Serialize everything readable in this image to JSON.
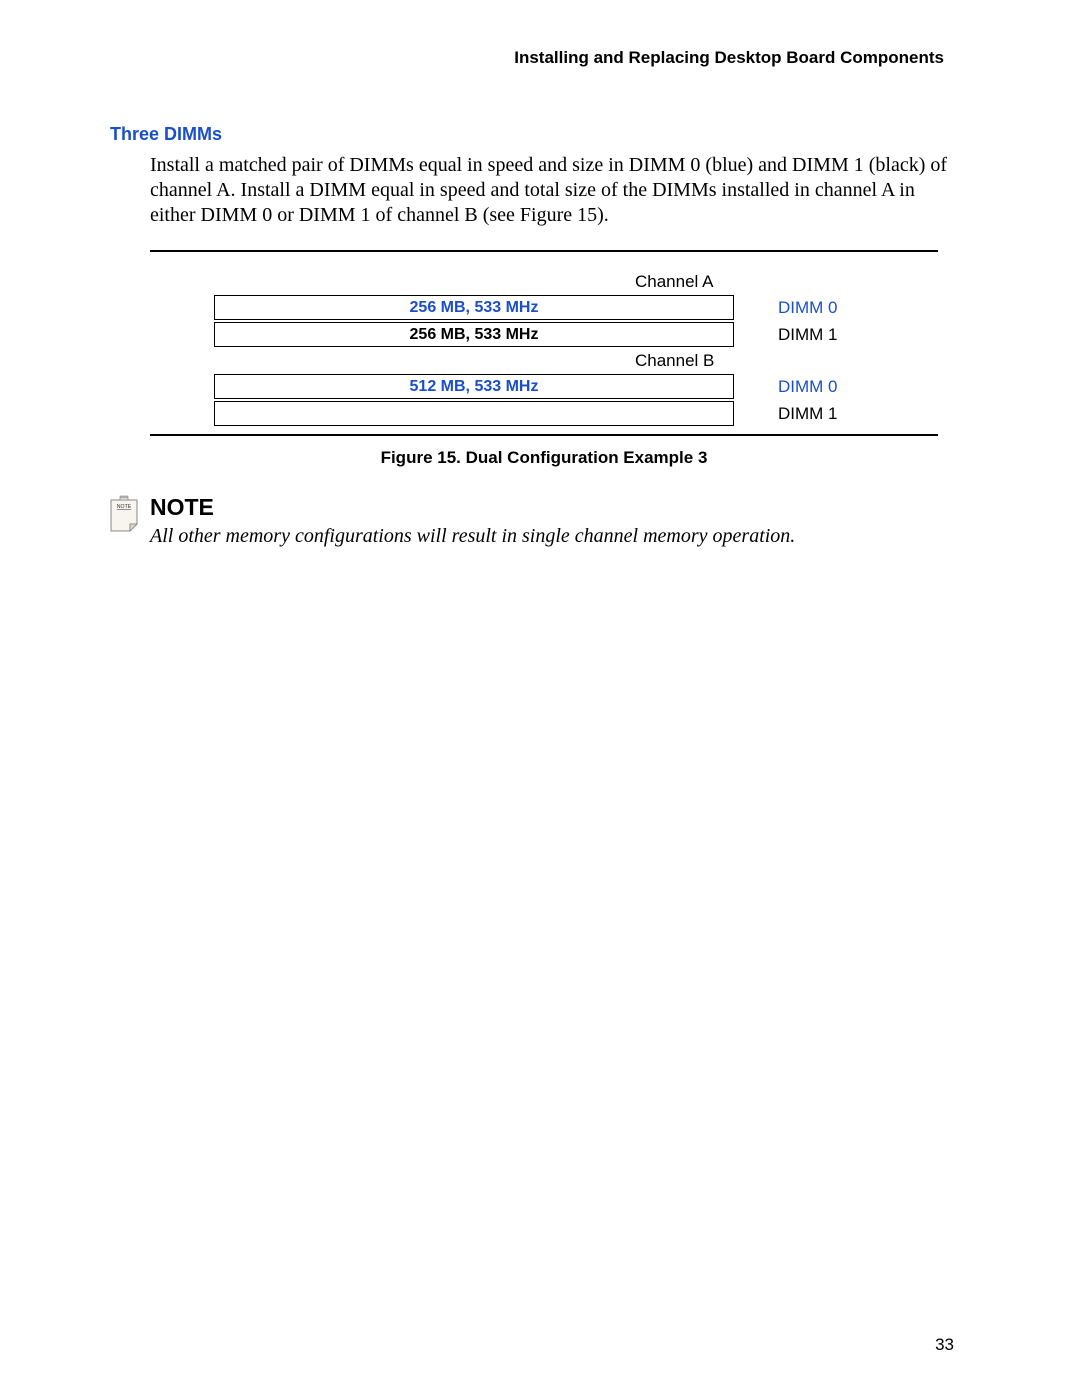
{
  "runningHeader": "Installing and Replacing Desktop Board Components",
  "sectionHeading": "Three DIMMs",
  "bodyText": "Install a matched pair of DIMMs equal in speed and size in DIMM 0 (blue) and DIMM 1 (black) of channel A.  Install a DIMM equal in speed and total size of the DIMMs installed in channel A in either DIMM 0 or DIMM 1 of channel B (see Figure 15).",
  "figure": {
    "channelA": {
      "label": "Channel A",
      "dimm0": {
        "text": "256 MB, 533 MHz",
        "label": "DIMM 0"
      },
      "dimm1": {
        "text": "256 MB, 533 MHz",
        "label": "DIMM 1"
      }
    },
    "channelB": {
      "label": "Channel B",
      "dimm0": {
        "text": "512 MB, 533 MHz",
        "label": "DIMM 0"
      },
      "dimm1": {
        "text": "",
        "label": "DIMM 1"
      }
    },
    "caption": "Figure 15.  Dual Configuration Example 3"
  },
  "note": {
    "heading": "NOTE",
    "text": "All other memory configurations will result in single channel memory operation.",
    "iconLabel": "NOTE"
  },
  "pageNumber": "33"
}
